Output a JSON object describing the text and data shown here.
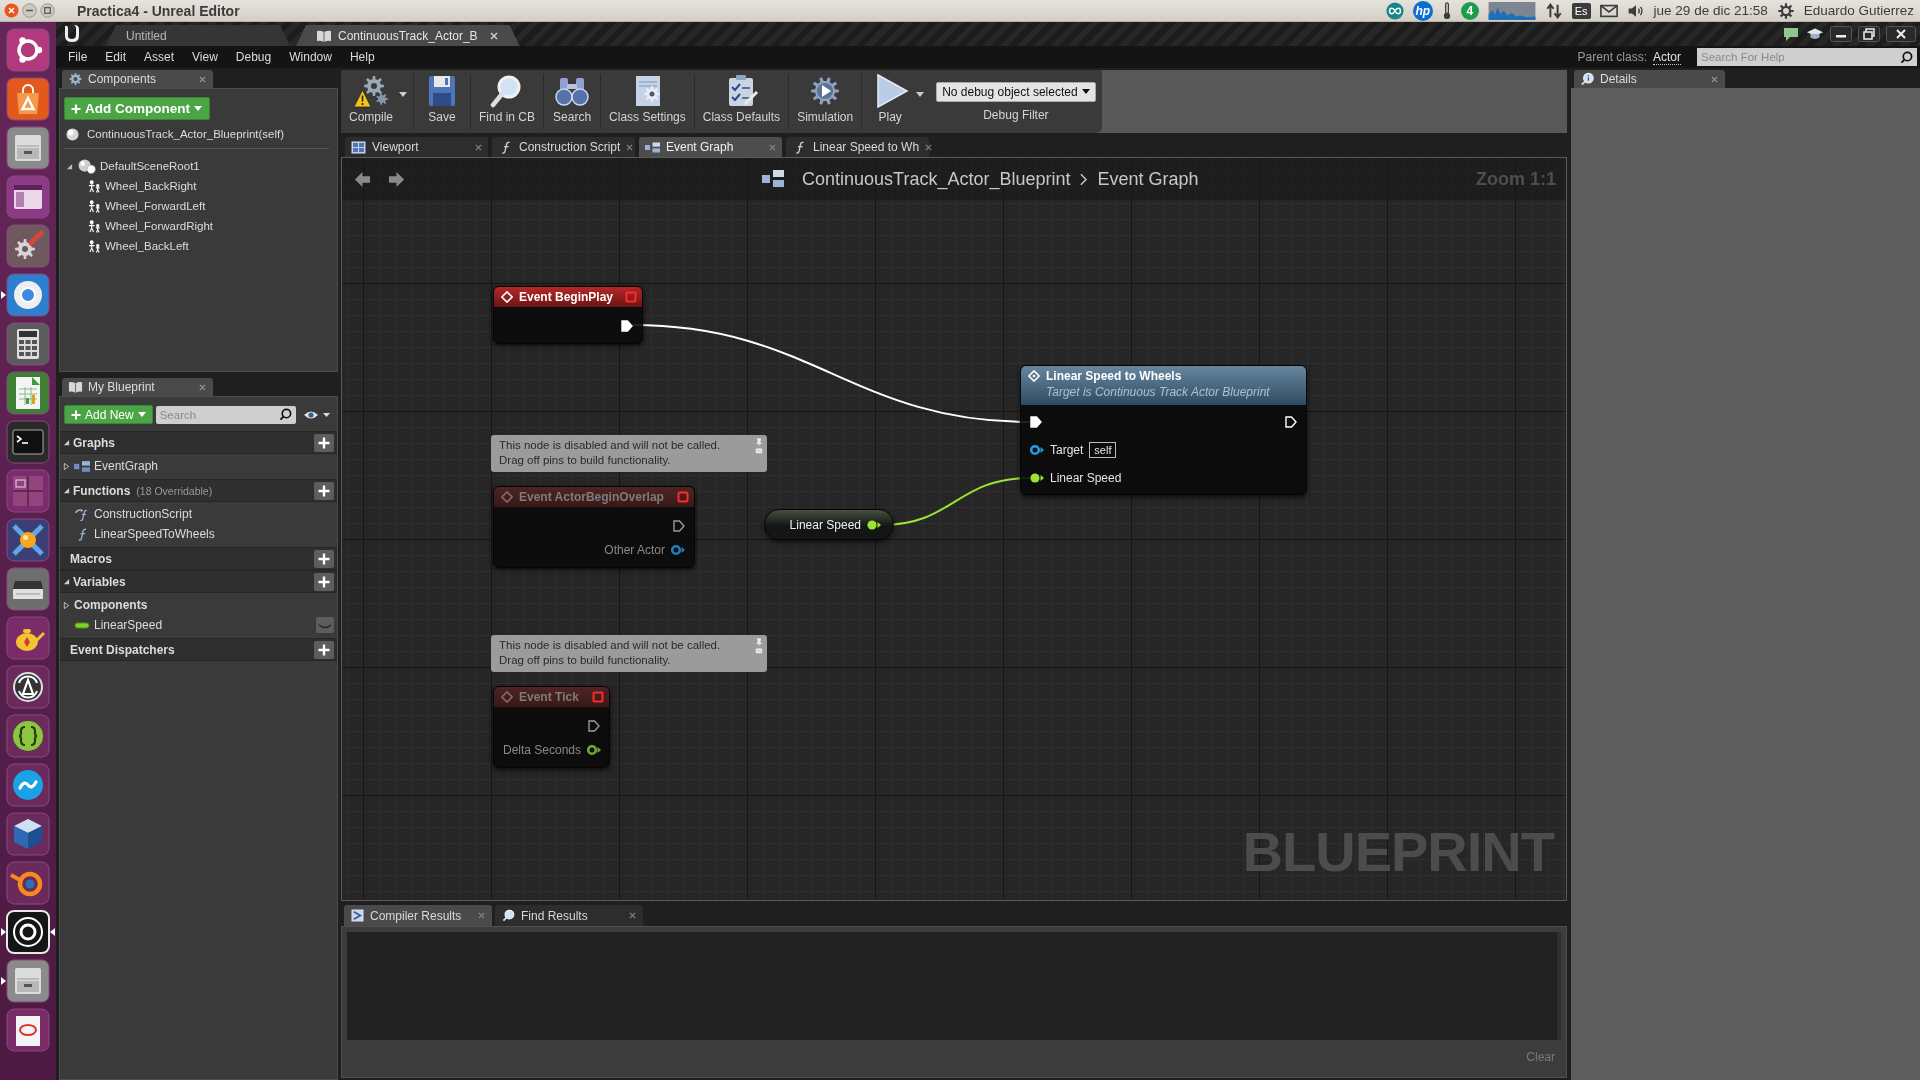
{
  "desktop_bar": {
    "window_title": "Practica4 - Unreal Editor",
    "indicators": [
      {
        "kind": "infinity"
      },
      {
        "kind": "logo",
        "text": "hp"
      },
      {
        "kind": "thermometer"
      },
      {
        "kind": "count",
        "text": "4"
      },
      {
        "kind": "load-graph"
      },
      {
        "kind": "network"
      },
      {
        "kind": "keyboard",
        "text": "Es"
      },
      {
        "kind": "mail"
      },
      {
        "kind": "volume"
      }
    ],
    "clock": "jue 29 de dic 21:58",
    "user": "Eduardo Gutierrez"
  },
  "launcher": {
    "items": [
      {
        "kind": "dash",
        "running": false,
        "focused": false
      },
      {
        "kind": "store",
        "running": false,
        "focused": false
      },
      {
        "kind": "files",
        "running": false,
        "focused": false
      },
      {
        "kind": "window",
        "running": false,
        "focused": false
      },
      {
        "kind": "settings",
        "running": false,
        "focused": false
      },
      {
        "kind": "browser",
        "running": true,
        "focused": false
      },
      {
        "kind": "calculator",
        "running": false,
        "focused": false
      },
      {
        "kind": "spreadsheet",
        "running": false,
        "focused": false
      },
      {
        "kind": "terminal",
        "running": false,
        "focused": false
      },
      {
        "kind": "workspaces",
        "running": false,
        "focused": false
      },
      {
        "kind": "media",
        "running": false,
        "focused": false
      },
      {
        "kind": "scanner",
        "running": false,
        "focused": false
      },
      {
        "kind": "teapot",
        "running": false,
        "focused": false
      },
      {
        "kind": "updater",
        "running": false,
        "focused": false
      },
      {
        "kind": "braces",
        "running": false,
        "focused": false
      },
      {
        "kind": "chat",
        "running": false,
        "focused": false
      },
      {
        "kind": "cube",
        "running": false,
        "focused": false
      },
      {
        "kind": "orbit",
        "running": false,
        "focused": false
      },
      {
        "kind": "engine",
        "running": true,
        "focused": true
      },
      {
        "kind": "files",
        "running": true,
        "focused": false
      },
      {
        "kind": "document",
        "running": false,
        "focused": false
      }
    ]
  },
  "editor": {
    "document_tabs": [
      {
        "label": "Untitled",
        "selected": false
      },
      {
        "label": "ContinuousTrack_Actor_B",
        "selected": true
      }
    ],
    "menu": [
      "File",
      "Edit",
      "Asset",
      "View",
      "Debug",
      "Window",
      "Help"
    ],
    "parent_class": {
      "label": "Parent class:",
      "value": "Actor"
    },
    "help_search": {
      "placeholder": "Search For Help"
    }
  },
  "components_panel": {
    "tab": "Components",
    "add_button": "Add Component",
    "self_row": "ContinuousTrack_Actor_Blueprint(self)",
    "tree": [
      {
        "kind": "scene",
        "label": "DefaultSceneRoot1",
        "expanded": true,
        "children": [
          {
            "kind": "mesh",
            "label": "Wheel_BackRight"
          },
          {
            "kind": "mesh",
            "label": "Wheel_ForwardLeft"
          },
          {
            "kind": "mesh",
            "label": "Wheel_ForwardRight"
          },
          {
            "kind": "mesh",
            "label": "Wheel_BackLeft"
          }
        ]
      }
    ]
  },
  "my_blueprint": {
    "tab": "My Blueprint",
    "add_button": "Add New",
    "search": {
      "placeholder": "Search"
    },
    "sections": [
      {
        "title": "Graphs",
        "expanded": true,
        "items": [
          {
            "kind": "graph",
            "label": "EventGraph",
            "expanded": false
          }
        ]
      },
      {
        "title": "Functions",
        "note": "(18 Overridable)",
        "expanded": true,
        "items": [
          {
            "kind": "override-function",
            "label": "ConstructionScript"
          },
          {
            "kind": "function",
            "label": "LinearSpeedToWheels"
          }
        ]
      },
      {
        "title": "Macros"
      },
      {
        "title": "Variables",
        "expanded": true,
        "items": [
          {
            "kind": "category",
            "label": "Components",
            "expanded": false
          },
          {
            "kind": "variable",
            "label": "LinearSpeed"
          }
        ]
      },
      {
        "title": "Event Dispatchers"
      }
    ]
  },
  "toolbar": {
    "buttons": [
      {
        "kind": "compile",
        "label": "Compile",
        "dropdown": true
      },
      {
        "kind": "save",
        "label": "Save",
        "dropdown": false
      },
      {
        "kind": "find",
        "label": "Find in CB",
        "dropdown": false
      },
      {
        "kind": "search",
        "label": "Search",
        "dropdown": false
      },
      {
        "kind": "class-settings",
        "label": "Class Settings",
        "dropdown": false
      },
      {
        "kind": "class-defaults",
        "label": "Class Defaults",
        "dropdown": false
      },
      {
        "kind": "simulation",
        "label": "Simulation",
        "dropdown": false
      },
      {
        "kind": "play",
        "label": "Play",
        "dropdown": true
      }
    ],
    "debug_filter": {
      "value": "No debug object selected",
      "label": "Debug Filter"
    }
  },
  "graph_tabs": [
    {
      "kind": "viewport",
      "label": "Viewport",
      "selected": false
    },
    {
      "kind": "function",
      "label": "Construction Script",
      "selected": false
    },
    {
      "kind": "graph",
      "label": "Event Graph",
      "selected": true
    },
    {
      "kind": "function",
      "label": "Linear Speed to Wh",
      "selected": false
    }
  ],
  "graph": {
    "breadcrumb": [
      "ContinuousTrack_Actor_Blueprint",
      "Event Graph"
    ],
    "zoom": "Zoom 1:1",
    "nodes": [
      {
        "kind": "event",
        "title": "Event BeginPlay",
        "disabled": false,
        "pins": [
          {
            "kind": "exec-out",
            "connected": true
          }
        ]
      },
      {
        "kind": "function-call",
        "title": "Linear Speed to Wheels",
        "subtitle": "Target is Continuous Track Actor Blueprint",
        "disabled": false,
        "pins": [
          {
            "kind": "exec-in",
            "connected": true
          },
          {
            "kind": "exec-out",
            "connected": false
          },
          {
            "kind": "data-in",
            "label": "Target",
            "default": "self",
            "color": "#1f9ee8",
            "connected": false
          },
          {
            "kind": "data-in",
            "label": "Linear Speed",
            "color": "#9be436",
            "connected": true
          }
        ]
      },
      {
        "kind": "event",
        "title": "Event ActorBeginOverlap",
        "disabled": true,
        "comment": "This node is disabled and will not be called.\nDrag off pins to build functionality.",
        "pins": [
          {
            "kind": "exec-out",
            "connected": false
          },
          {
            "kind": "data-out",
            "label": "Other Actor",
            "color": "#1a7fc0",
            "connected": false
          }
        ]
      },
      {
        "kind": "variable-get",
        "disabled": false,
        "pins": [
          {
            "kind": "data-out",
            "label": "Linear Speed",
            "color": "#9be436",
            "connected": true
          }
        ]
      },
      {
        "kind": "event",
        "title": "Event Tick",
        "disabled": true,
        "comment": "This node is disabled and will not be called.\nDrag off pins to build functionality.",
        "pins": [
          {
            "kind": "exec-out",
            "connected": false
          },
          {
            "kind": "data-out",
            "label": "Delta Seconds",
            "color": "#6fb02a",
            "connected": false
          }
        ]
      }
    ],
    "corner_label": "BLUEPRINT"
  },
  "bottom_panel": {
    "tabs": [
      {
        "kind": "compiler",
        "label": "Compiler Results",
        "selected": true
      },
      {
        "kind": "find",
        "label": "Find Results",
        "selected": false
      }
    ],
    "clear_button": "Clear"
  },
  "details_panel": {
    "tab": "Details"
  }
}
